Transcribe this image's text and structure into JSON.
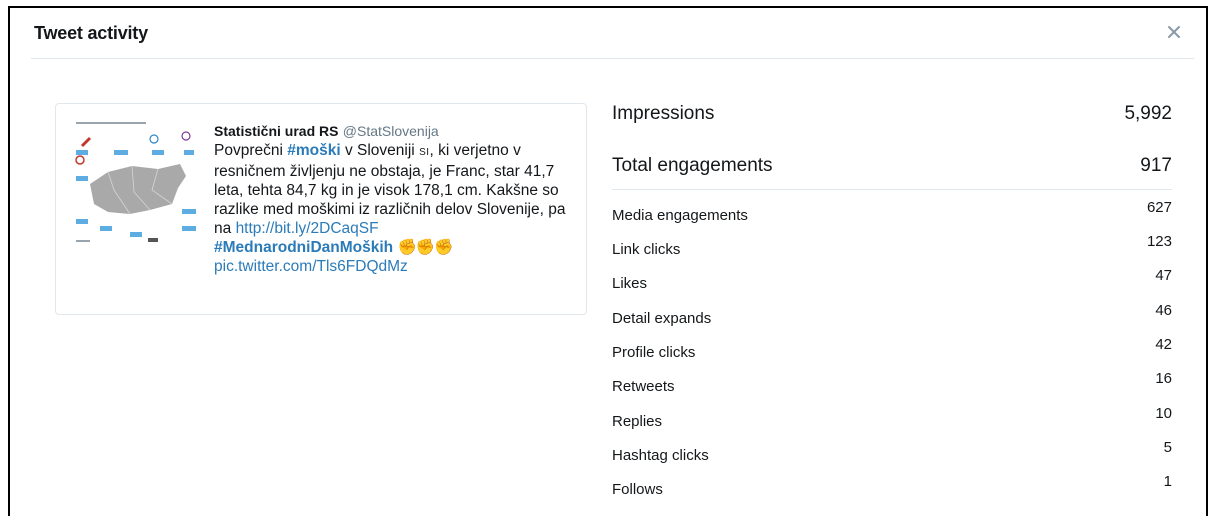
{
  "header": {
    "title": "Tweet activity",
    "close_label": "×"
  },
  "tweet": {
    "author_name": "Statistični urad RS",
    "author_handle": "@StatSlovenija",
    "t1": "Povprečni ",
    "hashtag1": "#moški",
    "t2": " v Sloveniji ",
    "sub": "SI",
    "t3": ", ki verjetno v resničnem življenju ne obstaja, je Franc, star 41,7 leta, tehta 84,7 kg in je visok 178,1 cm. Kakšne so razlike med moškimi iz različnih delov Slovenije, pa na ",
    "link1": "http://bit.ly/2DCaqSF",
    "hashtag2": "#MednarodniDanMoških",
    "hands": "✊✊✊",
    "link2": "pic.twitter.com/Tls6FDQdMz"
  },
  "metrics": {
    "impressions": {
      "label": "Impressions",
      "value": "5,992"
    },
    "total": {
      "label": "Total engagements",
      "value": "917"
    },
    "rows": [
      {
        "label": "Media engagements",
        "value": "627"
      },
      {
        "label": "Link clicks",
        "value": "123"
      },
      {
        "label": "Likes",
        "value": "47"
      },
      {
        "label": "Detail expands",
        "value": "46"
      },
      {
        "label": "Profile clicks",
        "value": "42"
      },
      {
        "label": "Retweets",
        "value": "16"
      },
      {
        "label": "Replies",
        "value": "10"
      },
      {
        "label": "Hashtag clicks",
        "value": "5"
      },
      {
        "label": "Follows",
        "value": "1"
      }
    ]
  },
  "colors": {
    "link": "#2b7bb9",
    "muted": "#657786",
    "border": "#e1e8ed",
    "close": "#8899a6"
  },
  "icons": {
    "close": "close-icon"
  }
}
